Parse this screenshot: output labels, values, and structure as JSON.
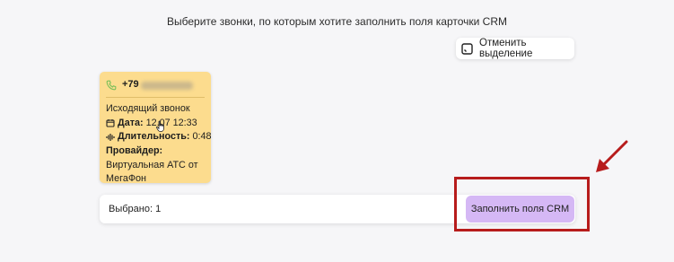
{
  "header": {
    "instruction": "Выберите звонки, по которым хотите заполнить поля карточки CRM"
  },
  "toolbar": {
    "deselect_label": "Отменить выделение",
    "deselect_icon": "checkbox-square-icon"
  },
  "call_card": {
    "phone_prefix": "+79",
    "type": "Исходящий звонок",
    "date_label": "Дата:",
    "date_value": "12.07 12:33",
    "duration_label": "Длительность:",
    "duration_value": "0:48",
    "provider_label": "Провайдер:",
    "provider_line1": "Виртуальная АТС от",
    "provider_line2": "МегаФон",
    "background_color": "#fcdc8e"
  },
  "footer": {
    "selected_text": "Выбрано: 1",
    "fill_button_label": "Заполнить поля CRM",
    "fill_button_color": "#d5b8f5"
  },
  "annotation": {
    "highlight_color": "#b71c1c"
  }
}
